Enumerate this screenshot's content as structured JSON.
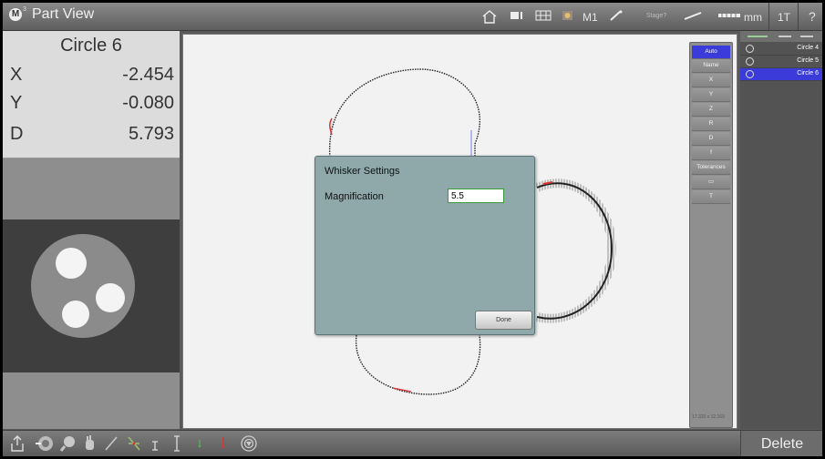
{
  "app": {
    "title": "Part View",
    "logo_letter": "M",
    "logo_sup": "3"
  },
  "toolbar": {
    "home_icon": "home-icon",
    "m1_label": "M1",
    "stage_label": "Stage?",
    "units_label": "mm",
    "tool_label": "1T",
    "help_label": "?"
  },
  "dro": {
    "feature_name": "Circle 6",
    "rows": [
      {
        "axis": "X",
        "value": "-2.454"
      },
      {
        "axis": "Y",
        "value": "-0.080"
      },
      {
        "axis": "D",
        "value": "5.793"
      }
    ]
  },
  "measure_column": {
    "items": [
      "Auto",
      "Name",
      "X",
      "Y",
      "Z",
      "R",
      "D",
      "f",
      "Tolerances",
      "▭",
      "T"
    ],
    "active": "Auto",
    "coordinates": "17.320 x 12.169"
  },
  "feature_list": {
    "items": [
      {
        "name": "Circle 4",
        "selected": false
      },
      {
        "name": "Circle 5",
        "selected": false
      },
      {
        "name": "Circle 6",
        "selected": true
      }
    ]
  },
  "dialog": {
    "title": "Whisker Settings",
    "magnification_label": "Magnification",
    "magnification_value": "5.5",
    "done_label": "Done"
  },
  "bottom": {
    "delete_label": "Delete"
  },
  "colors": {
    "accent": "#3b3bd9",
    "dialog_bg": "#8fa9aa",
    "canvas_bg": "#f2f2f2"
  }
}
